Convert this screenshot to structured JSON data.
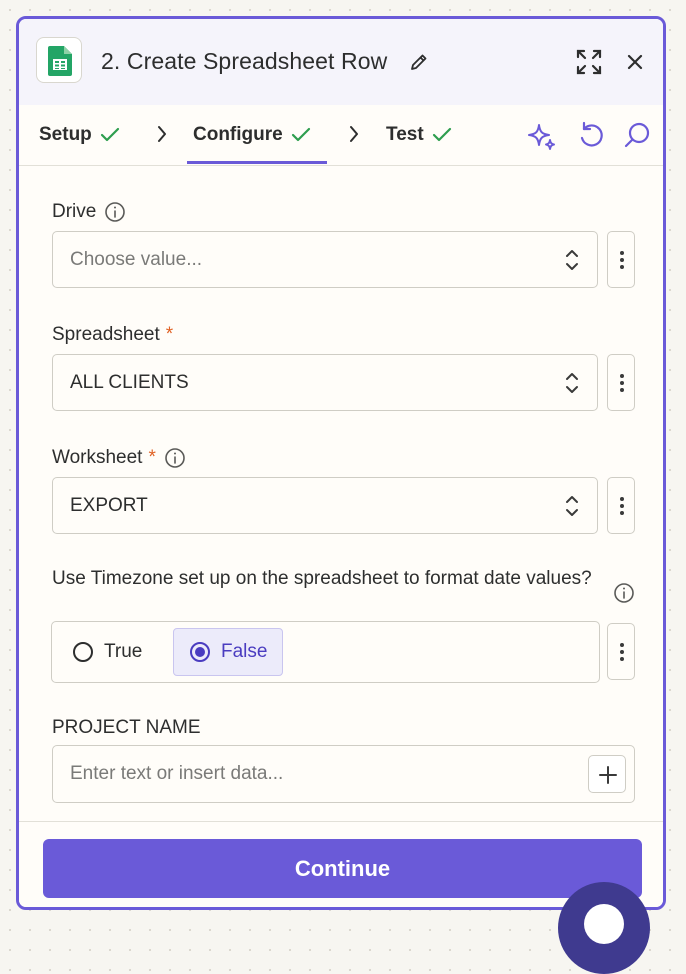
{
  "header": {
    "title": "2. Create Spreadsheet Row",
    "app_icon": "google-sheets-icon",
    "edit_icon": "pencil-icon",
    "expand_icon": "expand-icon",
    "close_icon": "close-icon"
  },
  "tabs": [
    {
      "label": "Setup",
      "status": "check"
    },
    {
      "label": "Configure",
      "status": "check",
      "active": true
    },
    {
      "label": "Test",
      "status": "check"
    }
  ],
  "toolbar_icons": [
    "sparkle-icon",
    "undo-icon",
    "search-icon"
  ],
  "fields": {
    "drive": {
      "label": "Drive",
      "placeholder": "Choose value...",
      "required": false,
      "has_info": true
    },
    "spreadsheet": {
      "label": "Spreadsheet",
      "value": "ALL CLIENTS",
      "required": true,
      "required_mark": "*"
    },
    "worksheet": {
      "label": "Worksheet",
      "value": "EXPORT",
      "required": true,
      "required_mark": "*",
      "has_info": true
    },
    "timezone": {
      "label": "Use Timezone set up on the spreadsheet to format date values?",
      "options": [
        "True",
        "False"
      ],
      "selected": "False"
    },
    "project_name": {
      "label": "PROJECT NAME",
      "placeholder": "Enter text or insert data..."
    }
  },
  "footer": {
    "continue_label": "Continue"
  },
  "colors": {
    "accent": "#6a5ad8",
    "success": "#2e9e4f",
    "required": "#e06226",
    "sheets_green": "#23a566"
  }
}
